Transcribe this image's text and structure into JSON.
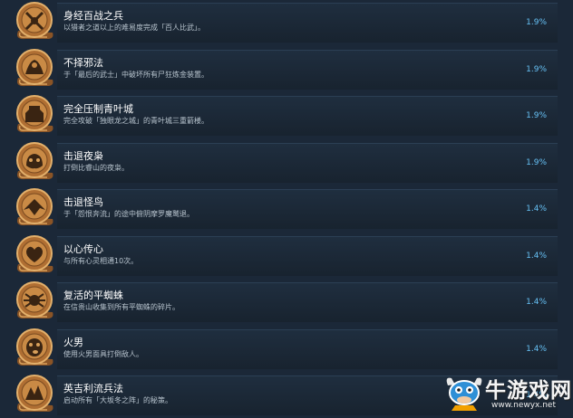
{
  "achievements": [
    {
      "title": "身经百战之兵",
      "desc": "以猎者之道以上的难易度完成「百人比武」。",
      "percent": "1.9%",
      "icon": "warrior-medal-icon"
    },
    {
      "title": "不择邪法",
      "desc": "于「最后的武士」中破坏所有尸狂炼金装置。",
      "percent": "1.9%",
      "icon": "alchemy-medal-icon"
    },
    {
      "title": "完全压制青叶城",
      "desc": "完全攻破「独眼龙之城」的青叶城三重箭楼。",
      "percent": "1.9%",
      "icon": "castle-medal-icon"
    },
    {
      "title": "击退夜枭",
      "desc": "打倒比睿山的夜枭。",
      "percent": "1.9%",
      "icon": "owl-medal-icon"
    },
    {
      "title": "击退怪鸟",
      "desc": "于「怨恨奔流」的途中俯阴摩罗魔鹫退。",
      "percent": "1.4%",
      "icon": "bird-medal-icon"
    },
    {
      "title": "以心传心",
      "desc": "与所有心灵相通10次。",
      "percent": "1.4%",
      "icon": "heart-medal-icon"
    },
    {
      "title": "复活的平蜘蛛",
      "desc": "在信贵山收集到所有平蜘蛛的碎片。",
      "percent": "1.4%",
      "icon": "spider-medal-icon"
    },
    {
      "title": "火男",
      "desc": "使用火男面具打倒敌人。",
      "percent": "1.4%",
      "icon": "mask-medal-icon"
    },
    {
      "title": "英吉利流兵法",
      "desc": "启动所有「大坂冬之阵」的秘策。",
      "percent": "1.4%",
      "icon": "strategy-medal-icon"
    }
  ],
  "watermark": {
    "name": "牛游戏网",
    "url": "www.newyx.net",
    "icon": "cow-mascot-icon"
  }
}
